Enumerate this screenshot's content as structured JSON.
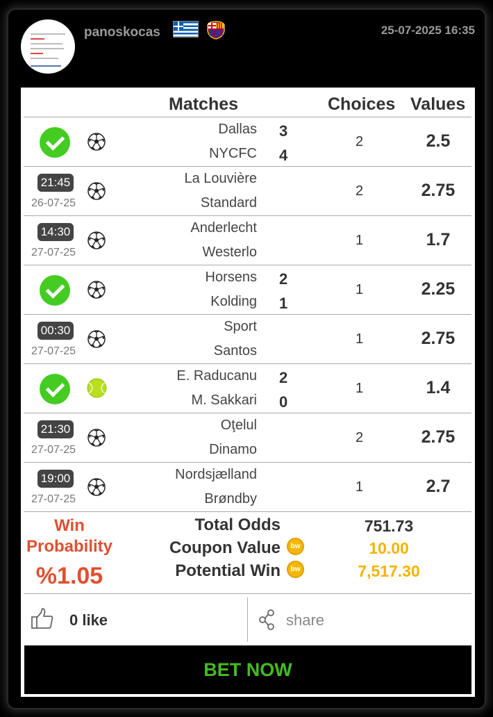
{
  "header": {
    "username": "panoskocas",
    "datetime": "25-07-2025 16:35",
    "colors": {
      "text": "#9a9a9a"
    }
  },
  "table": {
    "headers": {
      "matches": "Matches",
      "choices": "Choices",
      "values": "Values"
    },
    "rows": [
      {
        "status": "won",
        "sport": "football",
        "team1": "Dallas",
        "team2": "NYCFC",
        "score1": "3",
        "score2": "4",
        "time": "",
        "date": "",
        "choice": "2",
        "value": "2.5"
      },
      {
        "status": "pending",
        "sport": "football",
        "team1": "La Louvière",
        "team2": "Standard",
        "score1": "",
        "score2": "",
        "time": "21:45",
        "date": "26-07-25",
        "choice": "2",
        "value": "2.75"
      },
      {
        "status": "pending",
        "sport": "football",
        "team1": "Anderlecht",
        "team2": "Westerlo",
        "score1": "",
        "score2": "",
        "time": "14:30",
        "date": "27-07-25",
        "choice": "1",
        "value": "1.7"
      },
      {
        "status": "won",
        "sport": "football",
        "team1": "Horsens",
        "team2": "Kolding",
        "score1": "2",
        "score2": "1",
        "time": "",
        "date": "",
        "choice": "1",
        "value": "2.25"
      },
      {
        "status": "pending",
        "sport": "football",
        "team1": "Sport",
        "team2": "Santos",
        "score1": "",
        "score2": "",
        "time": "00:30",
        "date": "27-07-25",
        "choice": "1",
        "value": "2.75"
      },
      {
        "status": "won",
        "sport": "tennis",
        "team1": "E. Raducanu",
        "team2": "M. Sakkari",
        "score1": "2",
        "score2": "0",
        "time": "",
        "date": "",
        "choice": "1",
        "value": "1.4"
      },
      {
        "status": "pending",
        "sport": "football",
        "team1": "Oţelul",
        "team2": "Dinamo",
        "score1": "",
        "score2": "",
        "time": "21:30",
        "date": "27-07-25",
        "choice": "2",
        "value": "2.75"
      },
      {
        "status": "pending",
        "sport": "football",
        "team1": "Nordsjælland",
        "team2": "Brøndby",
        "score1": "",
        "score2": "",
        "time": "19:00",
        "date": "27-07-25",
        "choice": "1",
        "value": "2.7"
      }
    ]
  },
  "summary": {
    "win_label_1": "Win",
    "win_label_2": "Probability",
    "win_value": "%1.05",
    "total_odds_label": "Total Odds",
    "total_odds_value": "751.73",
    "coupon_label": "Coupon Value",
    "coupon_value": "10.00",
    "potential_label": "Potential Win",
    "potential_value": "7,517.30",
    "coin_text": "bw",
    "colors": {
      "win": "#e05030",
      "coin": "#f3b400"
    }
  },
  "social": {
    "like_text": "0 like",
    "share_text": "share"
  },
  "bet_button": {
    "label": "BET NOW",
    "color": "#44bb22"
  }
}
